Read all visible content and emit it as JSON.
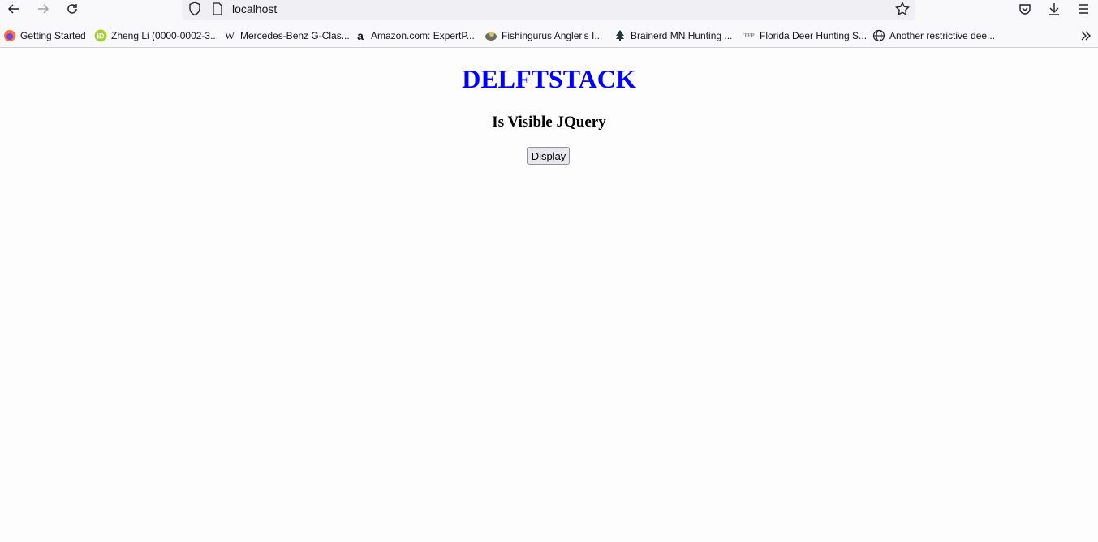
{
  "browser": {
    "url": "localhost",
    "bookmarks": [
      {
        "label": "Getting Started",
        "icon": "firefox-icon"
      },
      {
        "label": "Zheng Li (0000-0002-3...",
        "icon": "orcid-icon"
      },
      {
        "label": "Mercedes-Benz G-Clas...",
        "icon": "wikipedia-icon",
        "glyph": "W"
      },
      {
        "label": "Amazon.com: ExpertP...",
        "icon": "amazon-icon",
        "glyph": "a"
      },
      {
        "label": "Fishingurus Angler's I...",
        "icon": "fishingurus-icon"
      },
      {
        "label": "Brainerd MN Hunting ...",
        "icon": "tree-icon"
      },
      {
        "label": "Florida Deer Hunting S...",
        "icon": "tfp-icon",
        "glyph": "TFP"
      },
      {
        "label": "Another restrictive dee...",
        "icon": "globe-icon"
      }
    ]
  },
  "page": {
    "title": "DELFTSTACK",
    "subtitle": "Is Visible JQuery",
    "button_label": "Display"
  },
  "colors": {
    "title": "#0000ff",
    "chrome": "#f9f9fb",
    "urlbar": "#f0f0f4"
  }
}
